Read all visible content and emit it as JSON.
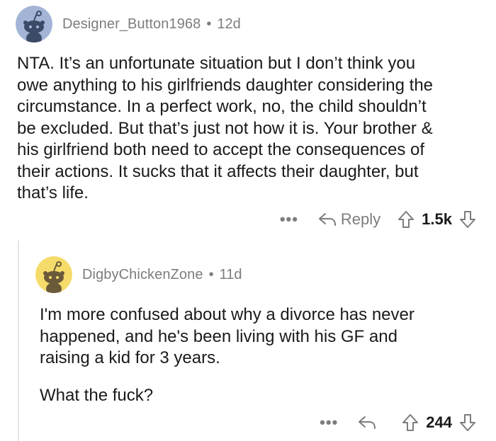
{
  "comments": [
    {
      "username": "Designer_Button1968",
      "separator": "•",
      "age": "12d",
      "body_lines": [
        "NTA. It’s an unfortunate situation but I don’t think you",
        "owe anything to his girlfriends daughter considering the",
        "circumstance. In a perfect work, no, the child shouldn’t",
        "be excluded. But that’s just not how it is. Your brother &",
        "his girlfriend both need to accept the consequences of",
        "their actions. It sucks that it affects their daughter, but",
        "that’s life."
      ],
      "more": "•••",
      "reply_label": "Reply",
      "score": "1.5k",
      "avatar_color": "#a3b4d6"
    },
    {
      "username": "DigbyChickenZone",
      "separator": "•",
      "age": "11d",
      "body_lines": [
        "I'm more confused about why a divorce has never",
        "happened, and he's been living with his GF and",
        "raising a kid for 3 years.",
        "",
        "What the fuck?"
      ],
      "more": "•••",
      "score": "244",
      "avatar_color": "#f5dc6a"
    }
  ],
  "icons": {
    "reply": "reply-arrow-icon",
    "upvote": "upvote-arrow-icon",
    "downvote": "downvote-arrow-icon",
    "more": "more-dots-icon"
  }
}
